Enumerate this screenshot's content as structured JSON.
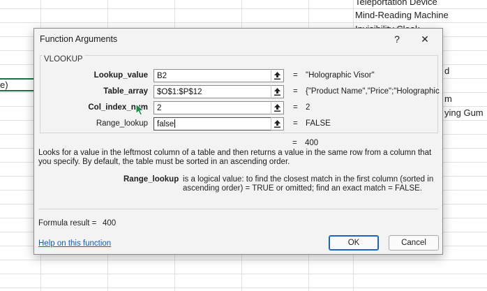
{
  "sheet": {
    "cells_right": [
      "Teleportation Device",
      "Mind-Reading Machine",
      "Invisibility Cloak",
      "d",
      "m",
      "ying Gum"
    ],
    "cell_left": "e)"
  },
  "dialog": {
    "title": "Function Arguments",
    "help_glyph": "?",
    "close_glyph": "✕",
    "function_name": "VLOOKUP",
    "args": [
      {
        "label": "Lookup_value",
        "value": "B2",
        "result": "\"Holographic Visor\"",
        "bold": true
      },
      {
        "label": "Table_array",
        "value": "$O$1:$P$12",
        "result": "{\"Product Name\",\"Price\";\"Holographic",
        "bold": true
      },
      {
        "label": "Col_index_num",
        "value": "2",
        "result": "2",
        "bold": true
      },
      {
        "label": "Range_lookup",
        "value": "false",
        "result": "FALSE",
        "bold": false
      }
    ],
    "equals": "=",
    "function_result": "400",
    "description": "Looks for a value in the leftmost column of a table and then returns a value in the same row from a column that you specify. By default, the table must be sorted in an ascending order.",
    "param_name": "Range_lookup",
    "param_description": "is a logical value: to find the closest match in the first column (sorted in ascending order) = TRUE or omitted; find an exact match = FALSE.",
    "formula_result_label": "Formula result =",
    "formula_result_value": "400",
    "help_link": "Help on this function",
    "ok_label": "OK",
    "cancel_label": "Cancel"
  },
  "colors": {
    "accent": "#1a63c4",
    "link": "#0b5fbd",
    "cursor": "#1e8a4c"
  }
}
